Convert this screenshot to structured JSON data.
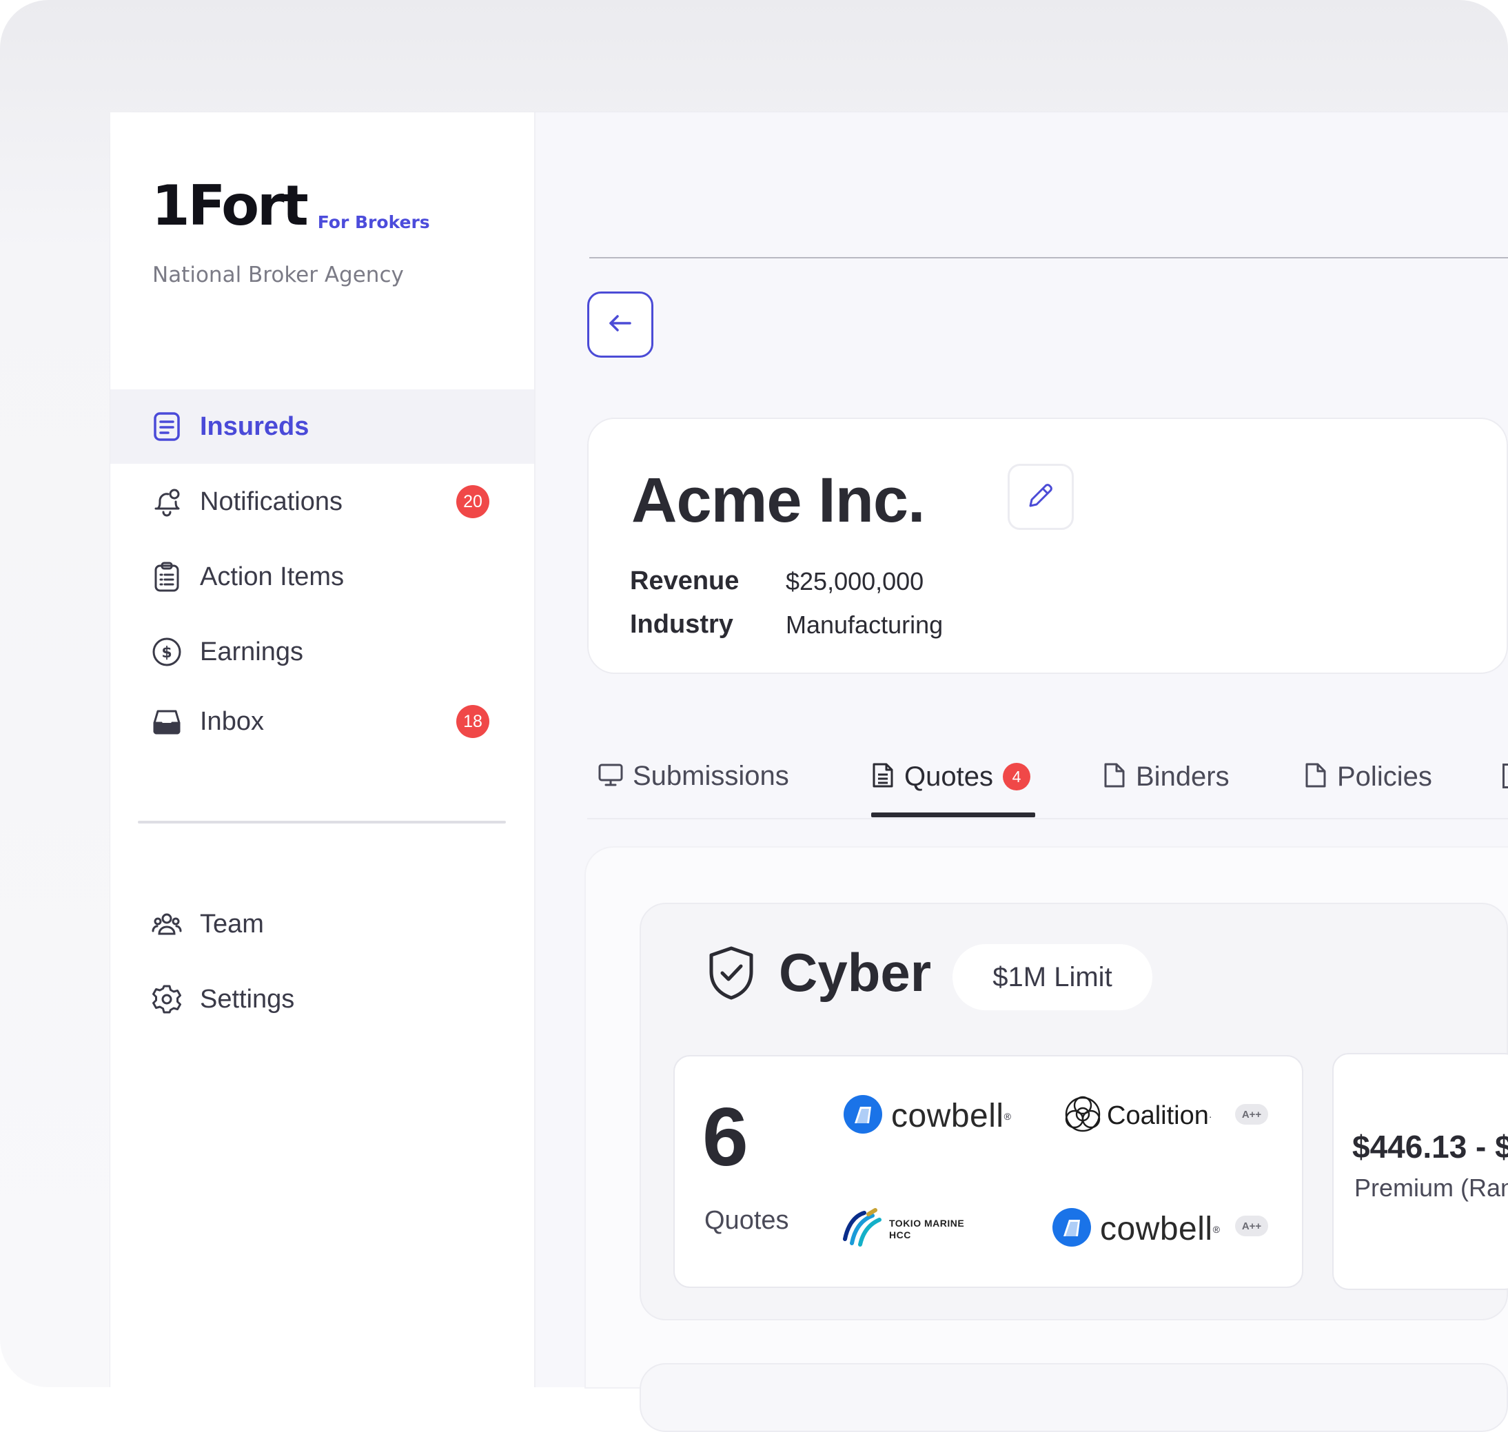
{
  "sidebar": {
    "brand": "1Fort",
    "brand_tag": "For Brokers",
    "agency": "National Broker Agency",
    "items": [
      {
        "label": "Insureds",
        "icon": "document-list-icon",
        "active": true
      },
      {
        "label": "Notifications",
        "icon": "bell-icon",
        "badge": "20"
      },
      {
        "label": "Action Items",
        "icon": "clipboard-list-icon"
      },
      {
        "label": "Earnings",
        "icon": "dollar-circle-icon"
      },
      {
        "label": "Inbox",
        "icon": "inbox-tray-icon",
        "badge": "18"
      }
    ],
    "bottom_items": [
      {
        "label": "Team",
        "icon": "team-users-icon"
      },
      {
        "label": "Settings",
        "icon": "gear-icon"
      }
    ]
  },
  "company": {
    "name": "Acme Inc.",
    "facts": [
      {
        "label": "Revenue",
        "value": "$25,000,000"
      },
      {
        "label": "Industry",
        "value": "Manufacturing"
      }
    ]
  },
  "tabs": [
    {
      "label": "Submissions",
      "icon": "monitor-icon"
    },
    {
      "label": "Quotes",
      "icon": "document-text-icon",
      "badge": "4",
      "active": true
    },
    {
      "label": "Binders",
      "icon": "file-icon"
    },
    {
      "label": "Policies",
      "icon": "file-icon"
    }
  ],
  "coverage": {
    "title": "Cyber",
    "icon": "shield-check-icon",
    "limit": "$1M Limit",
    "quote_count": "6",
    "quote_label": "Quotes",
    "carriers": [
      {
        "name": "cowbell",
        "rating": ""
      },
      {
        "name": "Coalition",
        "rating": "A++"
      },
      {
        "name_lines": [
          "TOKIO MARINE",
          "HCC"
        ],
        "rating": ""
      },
      {
        "name": "cowbell",
        "rating": "A++"
      }
    ],
    "premium_value": "$446.13 - $",
    "premium_label": "Premium (Ran"
  },
  "colors": {
    "accent": "#4a4ad8",
    "badge": "#f04848",
    "text": "#2b2b33"
  }
}
